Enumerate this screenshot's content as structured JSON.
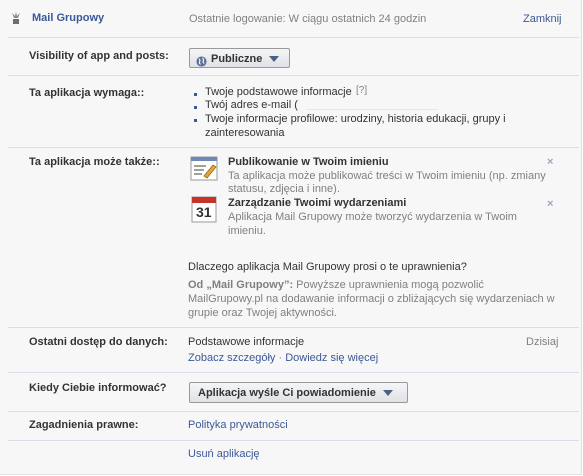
{
  "header": {
    "app_name": "Mail Grupowy",
    "last_login": "Ostatnie logowanie: W ciągu ostatnich 24 godzin",
    "close_label": "Zamknij"
  },
  "visibility": {
    "label": "Visibility of app and posts:",
    "button_label": "Publiczne"
  },
  "requires": {
    "label": "Ta aplikacja wymaga::",
    "items": [
      "Twoje podstawowe informacje",
      "Twój adres e-mail (",
      "Twoje informacje profilowe: urodziny, historia edukacji, grupy i",
      "zainteresowania"
    ],
    "help_marker": "[?]"
  },
  "also": {
    "label": "Ta aplikacja może także::",
    "perms": [
      {
        "title": "Publikowanie w Twoim imieniu",
        "desc1": "Ta aplikacja może publikować treści w Twoim imieniu (np. zmiany",
        "desc2": "statusu, zdjęcia i inne).",
        "remove": "×"
      },
      {
        "title": "Zarządzanie Twoimi wydarzeniami",
        "desc1": "Aplikacja Mail Grupowy może tworzyć wydarzenia w Twoim",
        "desc2": "imieniu.",
        "remove": "×",
        "calendar_number": "31"
      }
    ],
    "why_question": "Dlaczego aplikacja Mail Grupowy prosi o te uprawnienia?",
    "quote_from": "Od „Mail Grupowy”:",
    "quote_line1": " Powyższe uprawnienia mogą pozwolić",
    "quote_line2": "MailGrupowy.pl na dodawanie informacji o zbliżających się wydarzeniach w",
    "quote_line3": "grupie oraz Twojej aktywności."
  },
  "last_access": {
    "label": "Ostatni dostęp do danych:",
    "value": "Podstawowe informacje",
    "when": "Dzisiaj",
    "details_link": "Zobacz szczegóły",
    "separator": " · ",
    "learn_more_link": "Dowiedz się więcej"
  },
  "notify": {
    "label": "Kiedy Ciebie informować?",
    "button_label": "Aplikacja wyśle Ci powiadomienie"
  },
  "legal": {
    "label": "Zagadnienia prawne:",
    "privacy_link": "Polityka prywatności"
  },
  "remove_app_link": "Usuń aplikację",
  "colors": {
    "link": "#3b5998",
    "divider": "#d8dfea",
    "background": "#f7f7f7"
  }
}
